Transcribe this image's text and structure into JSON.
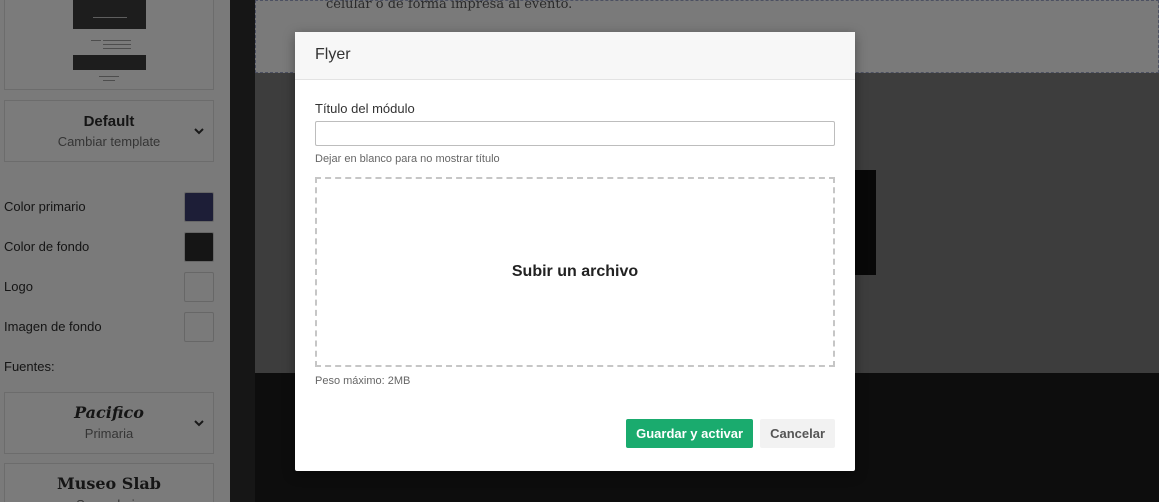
{
  "sidebar": {
    "template": {
      "name": "Default",
      "action": "Cambiar template"
    },
    "options": [
      {
        "label": "Color primario",
        "color": "#3b3d6e"
      },
      {
        "label": "Color de fondo",
        "color": "#2a2a2a"
      },
      {
        "label": "Logo",
        "color": "#f4f4f4"
      },
      {
        "label": "Imagen de fondo",
        "color": "#f4f4f4"
      }
    ],
    "fonts_label": "Fuentes:",
    "fonts": [
      {
        "name": "Pacifico",
        "role": "Primaria"
      },
      {
        "name": "Museo Slab",
        "role": "Secundaria"
      }
    ]
  },
  "canvas": {
    "paragraph_tail": "celular o de forma impresa al evento."
  },
  "modal": {
    "title": "Flyer",
    "field_label": "Título del módulo",
    "field_value": "",
    "field_help": "Dejar en blanco para no mostrar título",
    "dropzone_label": "Subir un archivo",
    "max_size": "Peso máximo: 2MB",
    "save_label": "Guardar y activar",
    "cancel_label": "Cancelar",
    "primary_color": "#1aab6e"
  }
}
